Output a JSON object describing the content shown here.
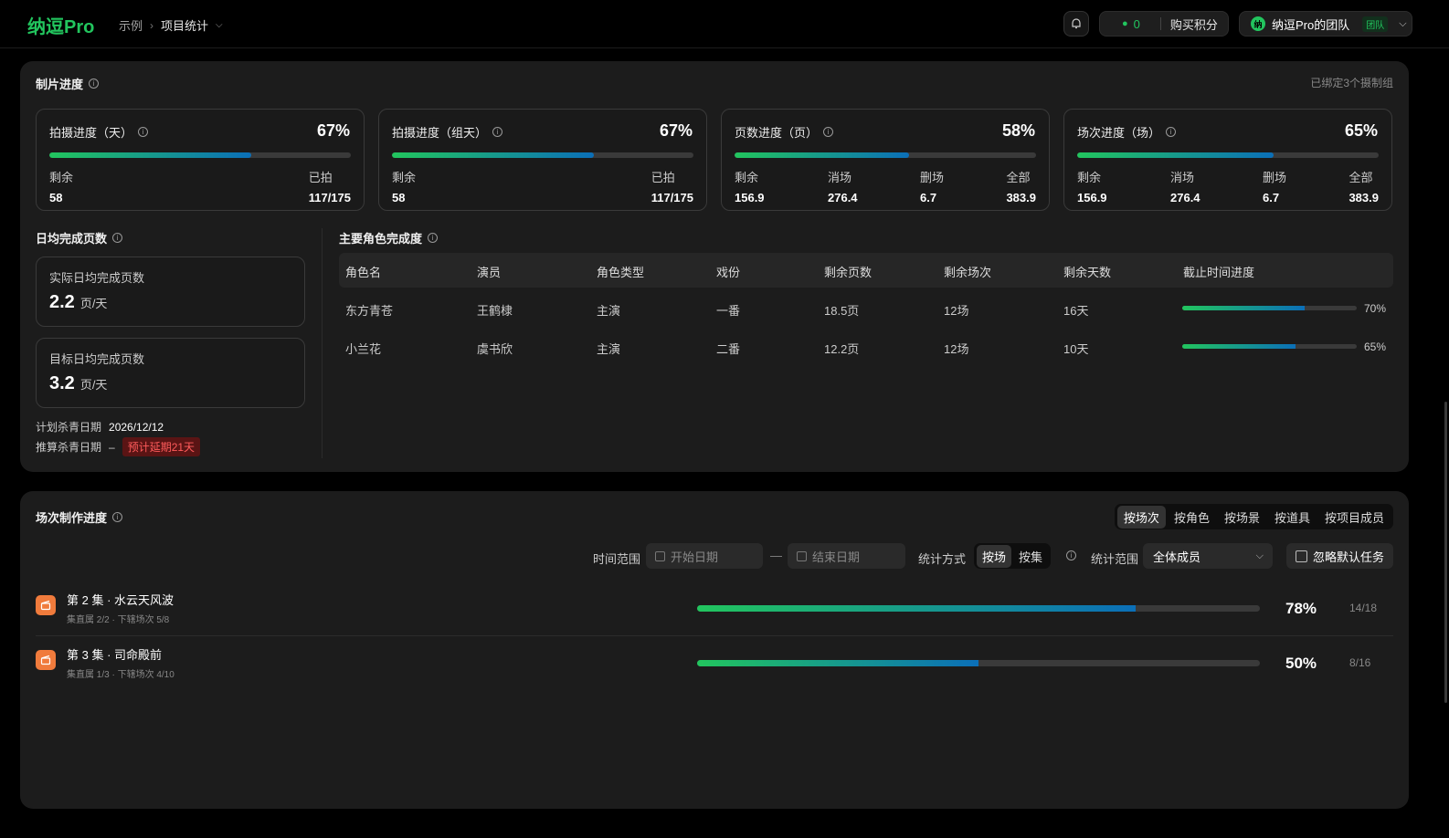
{
  "header": {
    "logo": "纳逗Pro",
    "breadcrumb_1": "示例",
    "breadcrumb_sep": "›",
    "breadcrumb_2": "项目统计",
    "points_value": "0",
    "buy_points": "购买积分",
    "team_avatar": "纳",
    "team_name": "纳逗Pro的团队",
    "team_badge": "团队"
  },
  "production": {
    "title": "制片进度",
    "bound_note": "已绑定3个摄制组",
    "cards": [
      {
        "title": "拍摄进度（天）",
        "percent_label": "67%",
        "percent": 67,
        "stats": [
          {
            "label": "剩余",
            "value": "58"
          },
          {
            "label": "已拍",
            "value": "117/175"
          }
        ]
      },
      {
        "title": "拍摄进度（组天）",
        "percent_label": "67%",
        "percent": 67,
        "stats": [
          {
            "label": "剩余",
            "value": "58"
          },
          {
            "label": "已拍",
            "value": "117/175"
          }
        ]
      },
      {
        "title": "页数进度（页）",
        "percent_label": "58%",
        "percent": 58,
        "stats": [
          {
            "label": "剩余",
            "value": "156.9"
          },
          {
            "label": "消场",
            "value": "276.4"
          },
          {
            "label": "删场",
            "value": "6.7"
          },
          {
            "label": "全部",
            "value": "383.9"
          }
        ]
      },
      {
        "title": "场次进度（场）",
        "percent_label": "65%",
        "percent": 65,
        "stats": [
          {
            "label": "剩余",
            "value": "156.9"
          },
          {
            "label": "消场",
            "value": "276.4"
          },
          {
            "label": "删场",
            "value": "6.7"
          },
          {
            "label": "全部",
            "value": "383.9"
          }
        ]
      }
    ],
    "daily": {
      "title": "日均完成页数",
      "actual_label": "实际日均完成页数",
      "actual_value": "2.2",
      "target_label": "目标日均完成页数",
      "target_value": "3.2",
      "unit": "页/天",
      "planned_wrap_label": "计划杀青日期",
      "planned_wrap_value": "2026/12/12",
      "estimated_wrap_label": "推算杀青日期",
      "estimated_wrap_value": "–",
      "delay_badge": "预计延期21天"
    },
    "roles": {
      "title": "主要角色完成度",
      "columns": [
        "角色名",
        "演员",
        "角色类型",
        "戏份",
        "剩余页数",
        "剩余场次",
        "剩余天数",
        "截止时间进度"
      ],
      "rows": [
        {
          "name": "东方青苍",
          "actor": "王鹤棣",
          "type": "主演",
          "rank": "一番",
          "pages": "18.5页",
          "scenes": "12场",
          "days": "16天",
          "progress_label": "70%",
          "progress": 70
        },
        {
          "name": "小兰花",
          "actor": "虞书欣",
          "type": "主演",
          "rank": "二番",
          "pages": "12.2页",
          "scenes": "12场",
          "days": "10天",
          "progress_label": "65%",
          "progress": 65
        }
      ]
    }
  },
  "scenes": {
    "title": "场次制作进度",
    "tabs": [
      "按场次",
      "按角色",
      "按场景",
      "按道具",
      "按项目成员"
    ],
    "active_tab": "按场次",
    "time_range_label": "时间范围",
    "start_placeholder": "开始日期",
    "end_placeholder": "结束日期",
    "range_sep": "—",
    "stat_method_label": "统计方式",
    "stat_methods": [
      "按场",
      "按集"
    ],
    "stat_scope_label": "统计范围",
    "stat_scope_value": "全体成员",
    "ignore_default": "忽略默认任务",
    "episodes": [
      {
        "title": "第 2 集 · 水云天风波",
        "sub": "集直属 2/2 · 下辖场次 5/8",
        "percent_label": "78%",
        "percent": 78,
        "count": "14/18"
      },
      {
        "title": "第 3 集 · 司命殿前",
        "sub": "集直属 1/3 · 下辖场次 4/10",
        "percent_label": "50%",
        "percent": 50,
        "count": "8/16"
      }
    ]
  }
}
